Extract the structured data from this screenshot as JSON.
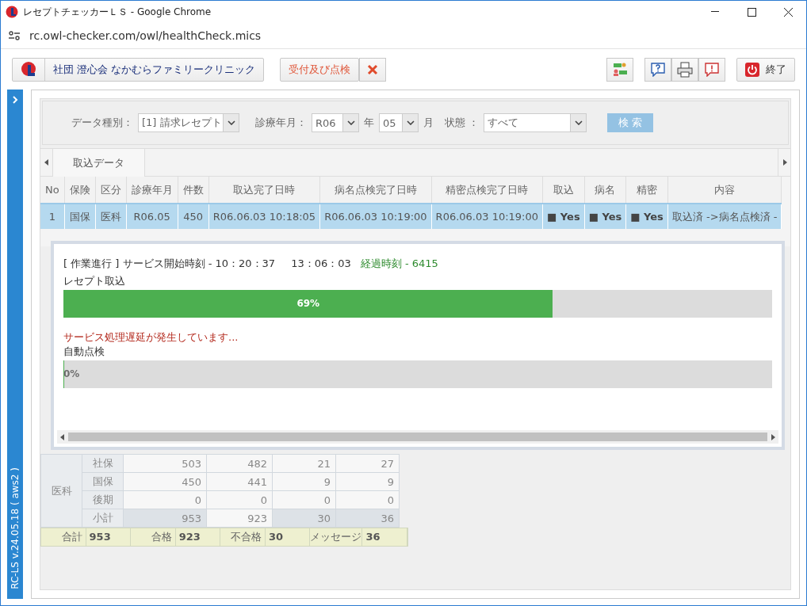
{
  "window": {
    "title": "レセプトチェッカーＬＳ - Google Chrome",
    "address": "rc.owl-checker.com/owl/healthCheck.mics"
  },
  "toolbar": {
    "clinic": "社団 澄心会 なかむらファミリークリニック",
    "reception": "受付及び点検",
    "exit": "終了"
  },
  "sidebar": {
    "version": "RC-LS v.24.05.18 ( aws2 )"
  },
  "filter": {
    "data_type_label": "データ種別：",
    "data_type": "[1] 請求レセプト",
    "month_label": "診療年月：",
    "era": "R06",
    "year_unit": "年",
    "month": "05",
    "month_unit": "月",
    "status_label": "状態 ：",
    "status": "すべて",
    "search": "検 索"
  },
  "tabs": [
    {
      "label": "取込データ",
      "selected": true
    }
  ],
  "table": {
    "columns": [
      "No",
      "保険",
      "区分",
      "診療年月",
      "件数",
      "取込完了日時",
      "病名点検完了日時",
      "精密点検完了日時",
      "取込",
      "病名",
      "精密",
      "内容"
    ],
    "rows": [
      {
        "selected": true,
        "cells": [
          "1",
          "国保",
          "医科",
          "R06.05",
          "450",
          "R06.06.03 10:18:05",
          "R06.06.03 10:19:00",
          "R06.06.03 10:19:00",
          "■ Yes",
          "■ Yes",
          "■ Yes",
          "取込済 ->病名点検済 -"
        ]
      }
    ]
  },
  "progress_dialog": {
    "header": "[ 作業進行 ] サービス開始時刻 - 10：20：37",
    "clock": "13：06：03",
    "elapsed": "経過時刻 - 6415",
    "tasks": [
      {
        "label": "レセプト取込",
        "level": 0.69,
        "reading": "69%"
      },
      {
        "warning": "サービス処理遅延が発生しています...",
        "label": "自動点検",
        "level": 0,
        "reading": "0%"
      }
    ]
  },
  "summary_table": {
    "group": "医科",
    "rows": [
      {
        "kind": "item",
        "cells": [
          "社保",
          "503",
          "482",
          "21",
          "27"
        ]
      },
      {
        "kind": "item",
        "cells": [
          "国保",
          "450",
          "441",
          "9",
          "9"
        ]
      },
      {
        "kind": "item",
        "cells": [
          "後期",
          "0",
          "0",
          "0",
          "0"
        ]
      },
      {
        "kind": "subtotal",
        "cells": [
          "小計",
          "953",
          "923",
          "30",
          "36"
        ]
      }
    ]
  },
  "totals": [
    {
      "label": "合計",
      "value": "953"
    },
    {
      "label": "合格",
      "value": "923"
    },
    {
      "label": "不合格",
      "value": "30"
    },
    {
      "label": "メッセージ",
      "value": "36"
    }
  ]
}
